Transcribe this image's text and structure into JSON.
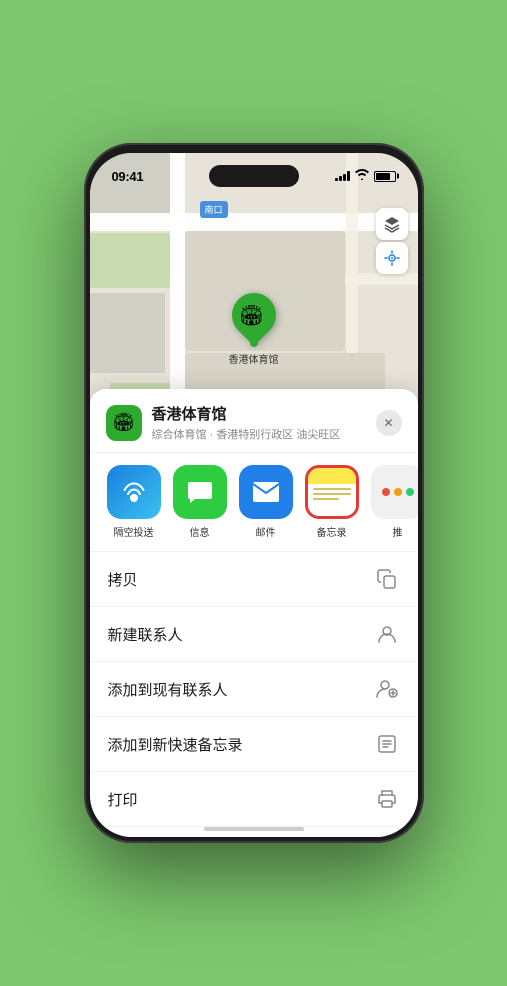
{
  "status_bar": {
    "time": "09:41",
    "signal_label": "signal",
    "wifi_label": "wifi",
    "battery_label": "battery"
  },
  "map": {
    "label": "南口",
    "marker_label": "香港体育馆"
  },
  "map_controls": {
    "layers_icon": "🗺",
    "location_icon": "➤"
  },
  "place": {
    "name": "香港体育馆",
    "subtitle": "综合体育馆 · 香港特别行政区 油尖旺区",
    "icon": "🏟",
    "close_label": "✕"
  },
  "share_actions": [
    {
      "id": "airdrop",
      "label": "隔空投送",
      "icon_class": "airdrop"
    },
    {
      "id": "messages",
      "label": "信息",
      "icon_class": "messages",
      "icon": "💬"
    },
    {
      "id": "mail",
      "label": "邮件",
      "icon_class": "mail",
      "icon": "✉"
    },
    {
      "id": "notes",
      "label": "备忘录",
      "icon_class": "notes"
    },
    {
      "id": "more",
      "label": "推",
      "icon_class": "more"
    }
  ],
  "menu_items": [
    {
      "id": "copy",
      "label": "拷贝",
      "icon": "⧉"
    },
    {
      "id": "new-contact",
      "label": "新建联系人",
      "icon": "👤"
    },
    {
      "id": "add-to-contact",
      "label": "添加到现有联系人",
      "icon": "👤+"
    },
    {
      "id": "add-to-notes",
      "label": "添加到新快速备忘录",
      "icon": "📋"
    },
    {
      "id": "print",
      "label": "打印",
      "icon": "🖨"
    }
  ]
}
